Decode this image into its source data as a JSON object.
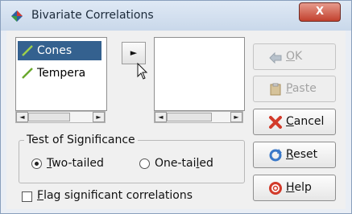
{
  "window": {
    "title": "Bivariate Correlations",
    "close_label": "X",
    "app_icon": "spss-diamond-icon"
  },
  "source_list": {
    "items": [
      {
        "label": "Cones",
        "icon": "scale-variable-icon",
        "selected": true
      },
      {
        "label": "Tempera",
        "icon": "scale-variable-icon",
        "selected": false
      }
    ]
  },
  "move_button": {
    "label": "►",
    "icon": "right-arrow-icon"
  },
  "target_list": {
    "items": []
  },
  "significance": {
    "group_label": "Test of Significance",
    "options": [
      {
        "label_pre": "",
        "label_key": "T",
        "label_post": "wo-tailed",
        "checked": true
      },
      {
        "label_pre": "One-tai",
        "label_key": "l",
        "label_post": "ed",
        "checked": false
      }
    ]
  },
  "flag": {
    "label_key": "F",
    "label_post": "lag significant correlations",
    "checked": false
  },
  "buttons": [
    {
      "id": "ok",
      "label_pre": "",
      "label_key": "O",
      "label_post": "K",
      "icon": "ok-arrow-icon",
      "enabled": false
    },
    {
      "id": "paste",
      "label_pre": "",
      "label_key": "P",
      "label_post": "aste",
      "icon": "clipboard-icon",
      "enabled": false
    },
    {
      "id": "cancel",
      "label_pre": "",
      "label_key": "C",
      "label_post": "ancel",
      "icon": "cancel-x-icon",
      "enabled": true
    },
    {
      "id": "reset",
      "label_pre": "",
      "label_key": "R",
      "label_post": "eset",
      "icon": "reset-arrows-icon",
      "enabled": true
    },
    {
      "id": "help",
      "label_pre": "",
      "label_key": "H",
      "label_post": "elp",
      "icon": "lifebuoy-icon",
      "enabled": true
    }
  ]
}
